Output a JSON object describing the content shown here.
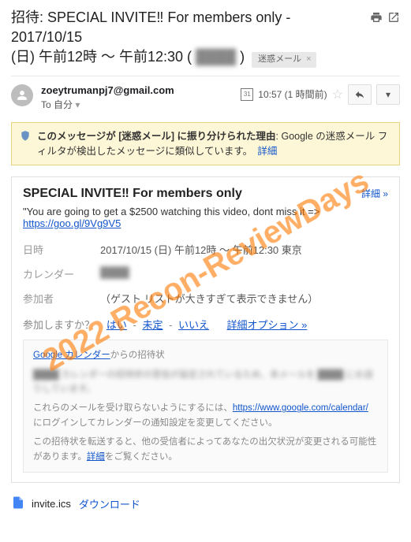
{
  "subject": {
    "line1": "招待: SPECIAL INVITE‼ For members only - 2017/10/15",
    "line2_a": "(日) 午前12時 ～ 午前12:30 (",
    "line2_redacted": "████",
    "line2_b": ")"
  },
  "label": {
    "text": "迷惑メール",
    "close": "×"
  },
  "header": {
    "from": "zoeytrumanpj7@gmail.com",
    "to_label": "To",
    "to_value": "自分",
    "date_num": "31",
    "time": "10:57 (1 時間前)"
  },
  "banner": {
    "prefix_bold": "このメッセージが [迷惑メール] に振り分けられた理由",
    "text": ": Google の迷惑メール フィルタが検出したメッセージに類似しています。　",
    "link": "詳細"
  },
  "card": {
    "title": "SPECIAL INVITE‼ For members only",
    "details_link": "詳細 »",
    "desc_a": "\"You are going to get a $2500 watching this video, dont miss it => ",
    "desc_link": "https://goo.gl/9Vg9V5",
    "rows": {
      "when_label": "日時",
      "when_value": "2017/10/15 (日) 午前12時 ～ 午前12:30 東京",
      "calendar_label": "カレンダー",
      "calendar_value": "████",
      "guests_label": "参加者",
      "guests_value": "（ゲスト リストが大きすぎて表示できません）"
    },
    "rsvp": {
      "label": "参加しますか？",
      "yes": "はい",
      "sep": " - ",
      "maybe": "未定",
      "no": "いいえ",
      "more": "詳細オプション »"
    }
  },
  "footer": {
    "line1_link": "Google カレンダー",
    "line1_text": "からの招待状",
    "line2_a": "████ カレンダーの招待状の受信が設定されているため、本メールを ████ にお送りしています。",
    "line3_a": "これらのメールを受け取らないようにするには、",
    "line3_link": "https://www.google.com/calendar/",
    "line3_b": " にログインしてカレンダーの通知設定を変更してください。",
    "line4_a": "この招待状を転送すると、他の受信者によってあなたの出欠状況が変更される可能性があります。",
    "line4_link": "詳細",
    "line4_b": "をご覧ください。"
  },
  "attachment": {
    "name": "invite.ics",
    "download": "ダウンロード"
  },
  "watermark": "2022 Recon-ReviewDays"
}
